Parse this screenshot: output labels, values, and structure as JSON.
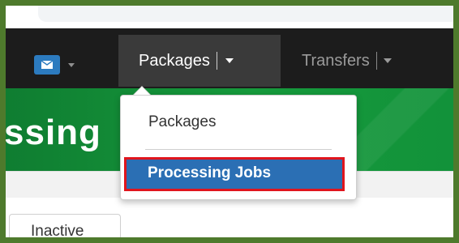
{
  "navbar": {
    "mail_icon": "envelope-icon",
    "packages_label": "Packages",
    "transfers_label": "Transfers"
  },
  "banner": {
    "title_fragment": "ssing"
  },
  "dropdown": {
    "items": [
      {
        "label": "Packages",
        "active": false
      },
      {
        "label": "Processing Jobs",
        "active": true
      }
    ],
    "highlight_color": "#e0151d",
    "active_bg": "#2b6fb4"
  },
  "tabs": {
    "inactive_label": "Inactive"
  },
  "colors": {
    "frame": "#4e7a2c",
    "navbar": "#1c1c1c",
    "banner": "#169a3c",
    "mail_button": "#2c7bbf"
  }
}
